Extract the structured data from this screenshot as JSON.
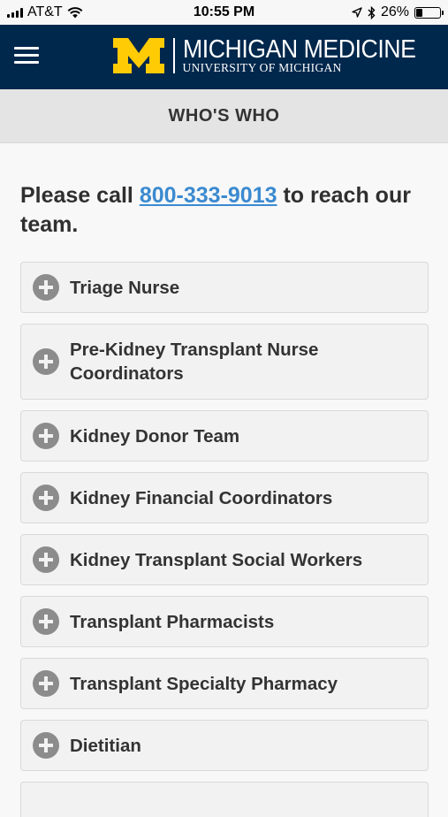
{
  "status_bar": {
    "carrier": "AT&T",
    "time": "10:55 PM",
    "battery_percent": "26%",
    "battery_level": 0.26,
    "icons": [
      "signal-icon",
      "wifi-icon",
      "location-icon",
      "bluetooth-icon",
      "battery-icon"
    ]
  },
  "header": {
    "brand_title": "MICHIGAN MEDICINE",
    "brand_subtitle": "UNIVERSITY OF MICHIGAN",
    "background_color": "#00274c",
    "maize_color": "#ffcb05"
  },
  "page": {
    "title": "WHO'S WHO"
  },
  "intro": {
    "prefix": "Please call ",
    "phone": "800-333-9013",
    "suffix": " to reach our team."
  },
  "accordion": {
    "items": [
      {
        "label": "Triage Nurse"
      },
      {
        "label": "Pre-Kidney Transplant Nurse Coordinators"
      },
      {
        "label": "Kidney Donor Team"
      },
      {
        "label": "Kidney Financial Coordinators"
      },
      {
        "label": "Kidney Transplant Social Workers"
      },
      {
        "label": "Transplant Pharmacists"
      },
      {
        "label": "Transplant Specialty Pharmacy"
      },
      {
        "label": "Dietitian"
      }
    ]
  }
}
